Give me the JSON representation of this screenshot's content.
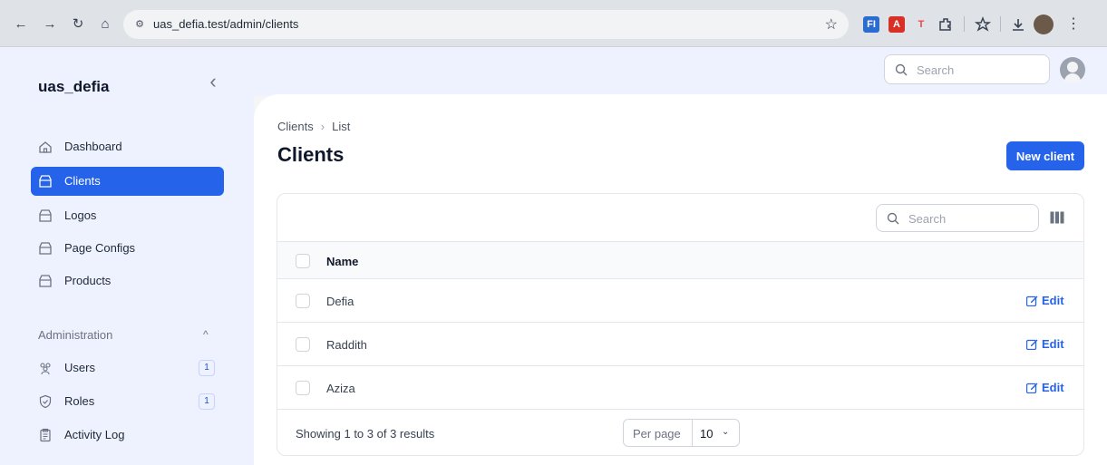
{
  "browser": {
    "url": "uas_defia.test/admin/clients",
    "back_icon": "←",
    "forward_icon": "→",
    "reload_icon": "↻",
    "home_icon": "⌂",
    "star_icon": "☆",
    "extensions": [
      {
        "name": "fi-extension-icon",
        "glyph": "FI",
        "color": "#2b6cd0"
      },
      {
        "name": "pdf-extension-icon",
        "glyph": "A",
        "color": "#d93025"
      },
      {
        "name": "t-extension-icon",
        "glyph": "T",
        "color": "#e8474c"
      }
    ]
  },
  "sidebar": {
    "brand": "uas_defia",
    "collapse_icon": "‹",
    "items": [
      {
        "label": "Dashboard",
        "active": false
      },
      {
        "label": "Clients",
        "active": true
      },
      {
        "label": "Logos",
        "active": false
      },
      {
        "label": "Page Configs",
        "active": false
      },
      {
        "label": "Products",
        "active": false
      }
    ],
    "group": {
      "label": "Administration",
      "chevron": "^",
      "items": [
        {
          "label": "Users",
          "badge": "1"
        },
        {
          "label": "Roles",
          "badge": "1"
        },
        {
          "label": "Activity Log",
          "badge": ""
        }
      ]
    }
  },
  "topbar": {
    "search_placeholder": "Search"
  },
  "page": {
    "breadcrumb": [
      "Clients",
      "List"
    ],
    "breadcrumb_sep": "›",
    "title": "Clients",
    "new_button": "New client"
  },
  "table": {
    "search_placeholder": "Search",
    "column": "Name",
    "edit_label": "Edit",
    "rows": [
      "Defia",
      "Raddith",
      "Aziza"
    ],
    "footer": "Showing 1 to 3 of 3 results",
    "per_page_label": "Per page",
    "per_page_value": "10",
    "per_page_chevron": "⌄"
  },
  "colors": {
    "accent": "#2563eb",
    "sidebar_bg": "#eef2ff"
  }
}
